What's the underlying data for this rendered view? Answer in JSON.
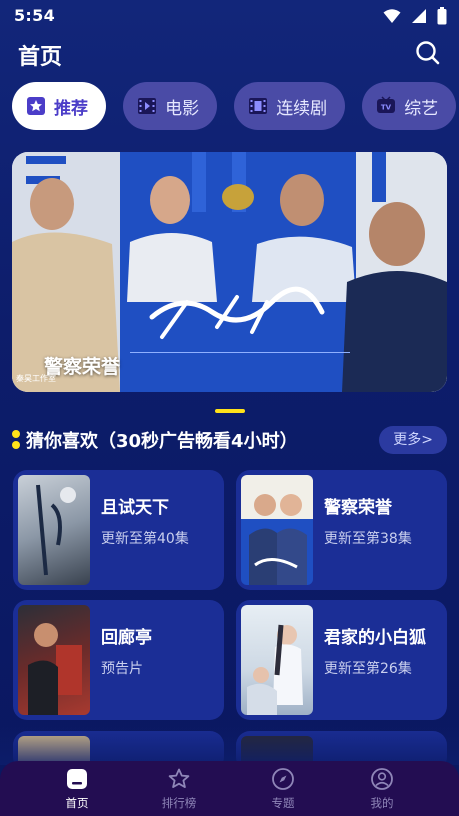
{
  "status": {
    "time": "5:54"
  },
  "header": {
    "title": "首页"
  },
  "tabs": [
    {
      "label": "推荐",
      "icon": "star-badge-icon"
    },
    {
      "label": "电影",
      "icon": "film-icon"
    },
    {
      "label": "连续剧",
      "icon": "film-strip-icon"
    },
    {
      "label": "综艺",
      "icon": "tv-icon"
    }
  ],
  "banner": {
    "title": "警察荣誉",
    "studio": "秦昊工作室"
  },
  "section": {
    "title": "猜你喜欢（30秒广告畅看4小时）",
    "more": "更多>"
  },
  "cards": [
    {
      "title": "且试天下",
      "subtitle": "更新至第40集"
    },
    {
      "title": "警察荣誉",
      "subtitle": "更新至第38集"
    },
    {
      "title": "回廊亭",
      "subtitle": "预告片"
    },
    {
      "title": "君家的小白狐",
      "subtitle": "更新至第26集"
    }
  ],
  "nav": [
    {
      "label": "首页",
      "icon": "home-icon"
    },
    {
      "label": "排行榜",
      "icon": "star-icon"
    },
    {
      "label": "专题",
      "icon": "compass-icon"
    },
    {
      "label": "我的",
      "icon": "user-icon"
    }
  ],
  "colors": {
    "accent": "#ffe21a",
    "active_tab_text": "#4b3dc8",
    "tab_bg": "#4a4ba6",
    "nav_bg": "#230d52"
  }
}
